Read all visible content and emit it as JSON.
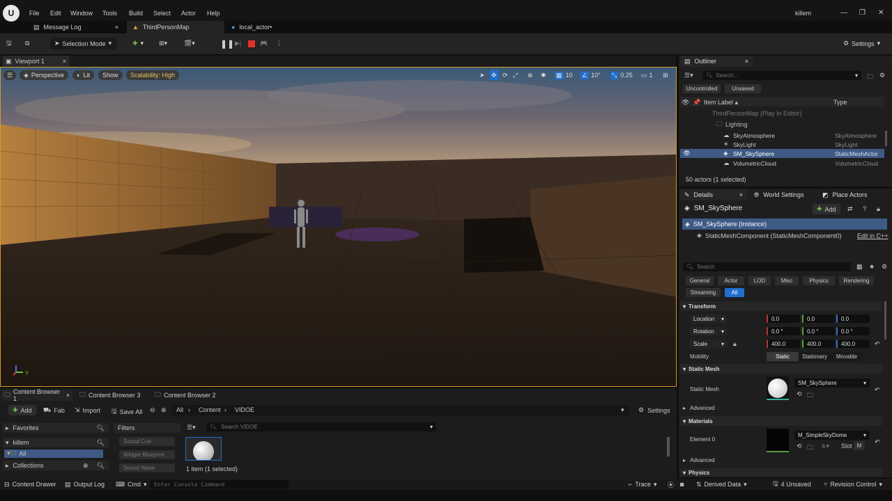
{
  "menu": [
    "File",
    "Edit",
    "Window",
    "Tools",
    "Build",
    "Select",
    "Actor",
    "Help"
  ],
  "user": "killem",
  "tabs": [
    {
      "label": "Message Log",
      "close": "×"
    },
    {
      "label": "ThirdPersonMap"
    },
    {
      "label": "local_actor•"
    }
  ],
  "toolbar": {
    "selection_mode": "Selection Mode",
    "settings": "Settings"
  },
  "viewport": {
    "tab": "Viewport 1",
    "close": "×",
    "perspective": "Perspective",
    "lit": "Lit",
    "show": "Show",
    "scalability": "Scalability: High",
    "grid_snap": "10",
    "rot_snap": "10°",
    "scale_snap": "0.25",
    "cam_speed": "1",
    "axis_y": "Y"
  },
  "outliner": {
    "title": "Outliner",
    "close": "×",
    "search_placeholder": "Search...",
    "filters": [
      "Uncontrolled",
      "Unsaved"
    ],
    "col_label": "Item Label ▴",
    "col_type": "Type",
    "map_label": "ThirdPersonMap (Play In Editor)",
    "folder": "Lighting",
    "rows": [
      {
        "label": "SkyAtmosphere",
        "type": "SkyAtmosphere"
      },
      {
        "label": "SkyLight",
        "type": "SkyLight"
      },
      {
        "label": "SM_SkySphere",
        "type": "StaticMeshActor",
        "selected": true
      },
      {
        "label": "VolumetricCloud",
        "type": "VolumetricCloud"
      }
    ],
    "footer": "50 actors (1 selected)"
  },
  "details": {
    "tabs": [
      {
        "label": "Details",
        "close": "×"
      },
      {
        "label": "World Settings"
      },
      {
        "label": "Place Actors"
      }
    ],
    "actor": "SM_SkySphere",
    "add": "Add",
    "instance": "SM_SkySphere (Instance)",
    "component": "StaticMeshComponent (StaticMeshComponent0)",
    "edit_cpp": "Edit in C++",
    "search_placeholder": "Search",
    "cats": [
      "General",
      "Actor",
      "LOD",
      "Misc",
      "Physics",
      "Rendering",
      "Streaming",
      "All"
    ],
    "transform": "Transform",
    "location_label": "Location",
    "location": [
      "0.0",
      "0.0",
      "0.0"
    ],
    "rotation_label": "Rotation",
    "rotation": [
      "0.0 °",
      "0.0 °",
      "0.0 °"
    ],
    "scale_label": "Scale",
    "scale": [
      "400.0",
      "400.0",
      "400.0"
    ],
    "mobility_label": "Mobility",
    "mobility": [
      "Static",
      "Stationary",
      "Movable"
    ],
    "static_mesh_section": "Static Mesh",
    "static_mesh_label": "Static Mesh",
    "static_mesh": "SM_SkySphere",
    "advanced": "Advanced",
    "materials_section": "Materials",
    "element_label": "Element 0",
    "material": "M_SimpleSkyDome",
    "slot": "Slot",
    "slot_value": "M",
    "advanced2": "Advanced",
    "physics": "Physics"
  },
  "content": {
    "tabs": [
      {
        "label": "Content Browser 1",
        "close": "×"
      },
      {
        "label": "Content Browser 3"
      },
      {
        "label": "Content Browser 2"
      }
    ],
    "add": "Add",
    "fab": "Fab",
    "import": "Import",
    "save_all": "Save All",
    "path": [
      "All",
      "Content",
      "VIDOE"
    ],
    "settings": "Settings",
    "favorites": "Favorites",
    "user_folder": "killem",
    "all": "All",
    "collections": "Collections",
    "filters": "Filters",
    "filter_items": [
      "Sound Cue",
      "Widget Blueprint",
      "Sound Wave"
    ],
    "search_placeholder": "Search VIDOE",
    "count": "1 item (1 selected)"
  },
  "status": {
    "content_drawer": "Content Drawer",
    "output_log": "Output Log",
    "cmd": "Cmd",
    "console_placeholder": "Enter Console Command",
    "trace": "Trace",
    "derived": "Derived Data",
    "unsaved": "4 Unsaved",
    "rev": "Revision Control"
  },
  "colors": {
    "accent": "#1f6fcf",
    "viewport_border": "#d39a2a",
    "play_red": "#e0322d"
  }
}
